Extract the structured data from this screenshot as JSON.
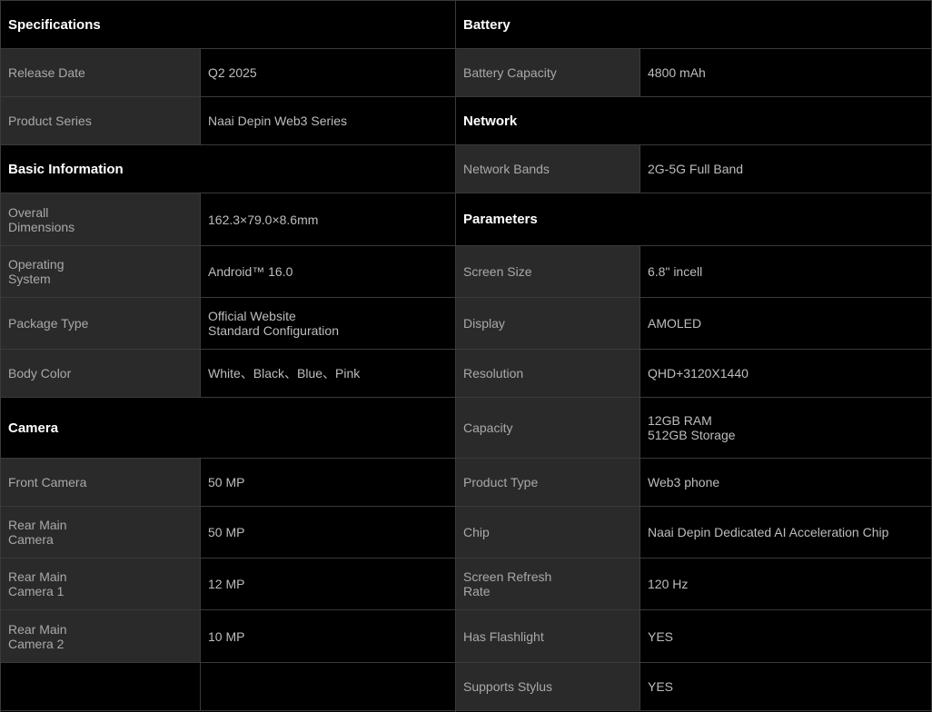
{
  "left": [
    {
      "type": "header",
      "title": "Specifications",
      "h": 53
    },
    {
      "type": "row",
      "label": "Release Date",
      "value": "Q2 2025",
      "h": 53
    },
    {
      "type": "row",
      "label": "Product Series",
      "value": "Naai Depin Web3 Series",
      "h": 53
    },
    {
      "type": "header",
      "title": "Basic Information",
      "h": 53
    },
    {
      "type": "row",
      "label": "Overall\nDimensions",
      "value": "162.3×79.0×8.6mm",
      "h": 58
    },
    {
      "type": "row",
      "label": "Operating\nSystem",
      "value": "Android™  16.0",
      "h": 57
    },
    {
      "type": "row",
      "label": "Package Type",
      "value": "Official Website\nStandard Configuration",
      "h": 57
    },
    {
      "type": "row",
      "label": "Body Color",
      "value": "White、Black、Blue、Pink",
      "h": 53
    },
    {
      "type": "header",
      "title": "Camera",
      "h": 67
    },
    {
      "type": "row",
      "label": "Front Camera",
      "value": "50 MP",
      "h": 53
    },
    {
      "type": "row",
      "label": "Rear Main\nCamera",
      "value": "50 MP",
      "h": 57
    },
    {
      "type": "row",
      "label": "Rear Main\nCamera 1",
      "value": "12 MP",
      "h": 57
    },
    {
      "type": "row",
      "label": "Rear Main\nCamera 2",
      "value": "10 MP",
      "h": 58
    },
    {
      "type": "empty",
      "label": "",
      "value": "",
      "h": 53
    }
  ],
  "right": [
    {
      "type": "header",
      "title": "Battery",
      "h": 53
    },
    {
      "type": "row",
      "label": "Battery Capacity",
      "value": "4800 mAh",
      "h": 53
    },
    {
      "type": "header",
      "title": "Network",
      "h": 53
    },
    {
      "type": "row",
      "label": "Network Bands",
      "value": "2G-5G Full Band",
      "h": 53
    },
    {
      "type": "header",
      "title": "Parameters",
      "h": 58
    },
    {
      "type": "row",
      "label": "Screen Size",
      "value": "6.8\" incell",
      "h": 57
    },
    {
      "type": "row",
      "label": "Display",
      "value": "AMOLED",
      "h": 57
    },
    {
      "type": "row",
      "label": "Resolution",
      "value": "QHD+3120X1440",
      "h": 53
    },
    {
      "type": "row",
      "label": "Capacity",
      "value": "12GB RAM\n512GB Storage",
      "h": 67
    },
    {
      "type": "row",
      "label": "Product Type",
      "value": "Web3 phone",
      "h": 53
    },
    {
      "type": "row",
      "label": "Chip",
      "value": "Naai Depin Dedicated AI Acceleration Chip",
      "h": 57
    },
    {
      "type": "row",
      "label": "Screen Refresh\nRate",
      "value": "120 Hz",
      "h": 57
    },
    {
      "type": "row",
      "label": "Has Flashlight",
      "value": "YES",
      "h": 58
    },
    {
      "type": "row",
      "label": "Supports Stylus",
      "value": "YES",
      "h": 53
    }
  ]
}
